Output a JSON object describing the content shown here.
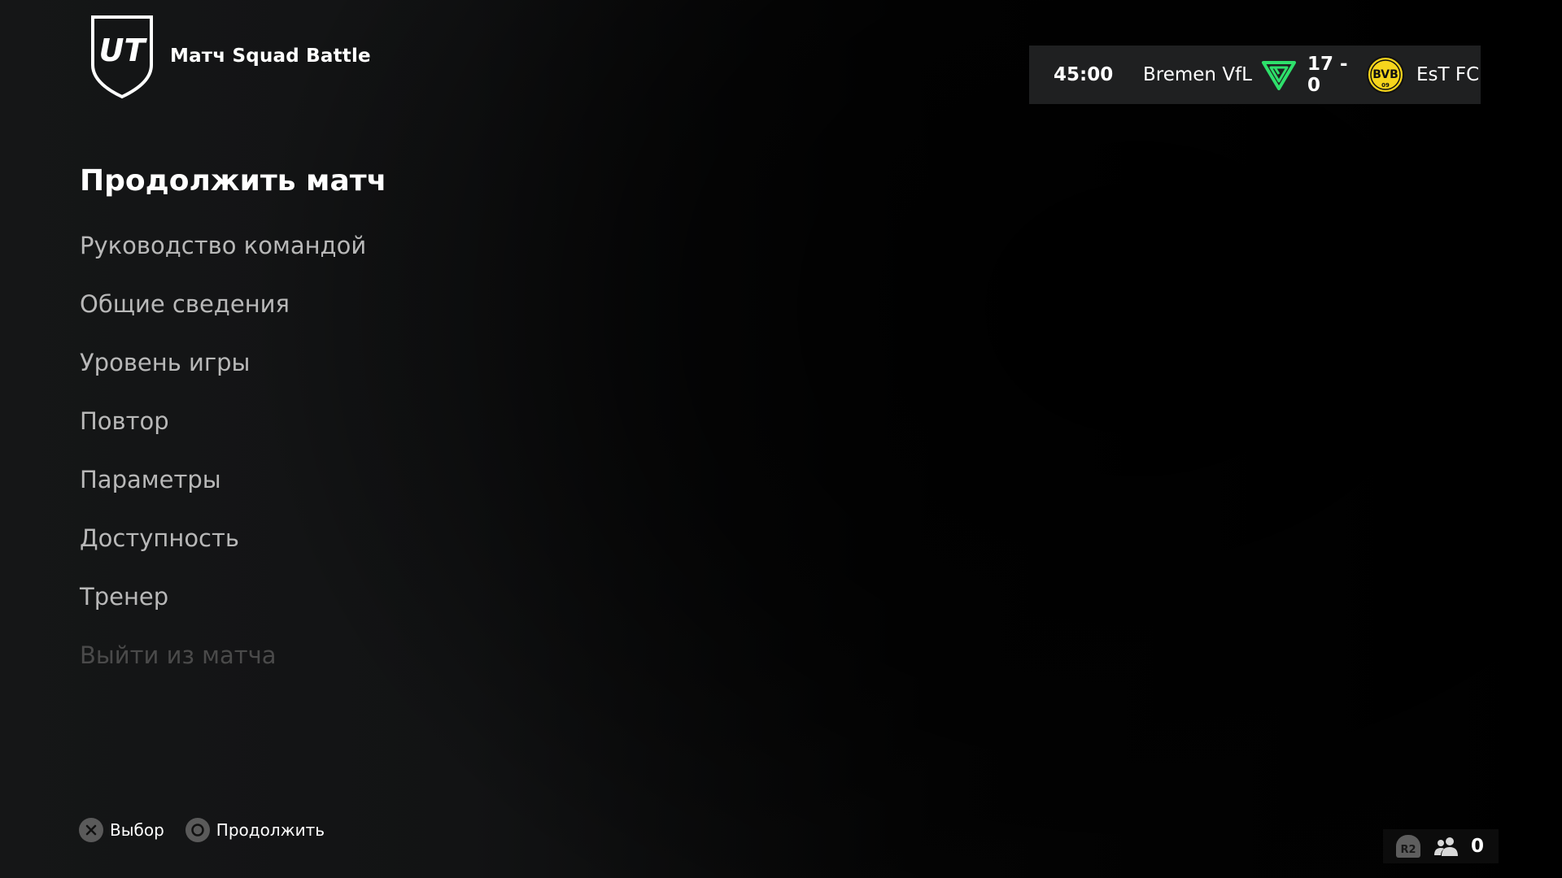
{
  "header": {
    "logo_text": "UT",
    "mode_title": "Матч Squad Battle"
  },
  "scoreboard": {
    "time": "45:00",
    "home_team": "Bremen VfL",
    "score": "17 - 0",
    "away_team": "EsT FC",
    "away_crest_text": "BVB",
    "away_crest_sub": "09",
    "colors": {
      "home_crest": "#2ee06b",
      "away_crest": "#f6d51c",
      "panel_bg": "#1f2021"
    }
  },
  "menu": {
    "items": [
      {
        "label": "Продолжить матч",
        "state": "selected"
      },
      {
        "label": "Руководство командой",
        "state": "normal"
      },
      {
        "label": "Общие сведения",
        "state": "normal"
      },
      {
        "label": "Уровень игры",
        "state": "normal"
      },
      {
        "label": "Повтор",
        "state": "normal"
      },
      {
        "label": "Параметры",
        "state": "normal"
      },
      {
        "label": "Доступность",
        "state": "normal"
      },
      {
        "label": "Тренер",
        "state": "normal"
      },
      {
        "label": "Выйти из матча",
        "state": "disabled"
      }
    ]
  },
  "hints": {
    "select_icon": "cross-button-icon",
    "select_label": "Выбор",
    "continue_icon": "circle-button-icon",
    "continue_label": "Продолжить"
  },
  "social": {
    "trigger_label": "R2",
    "friends_icon": "friends-icon",
    "friends_count": "0"
  }
}
